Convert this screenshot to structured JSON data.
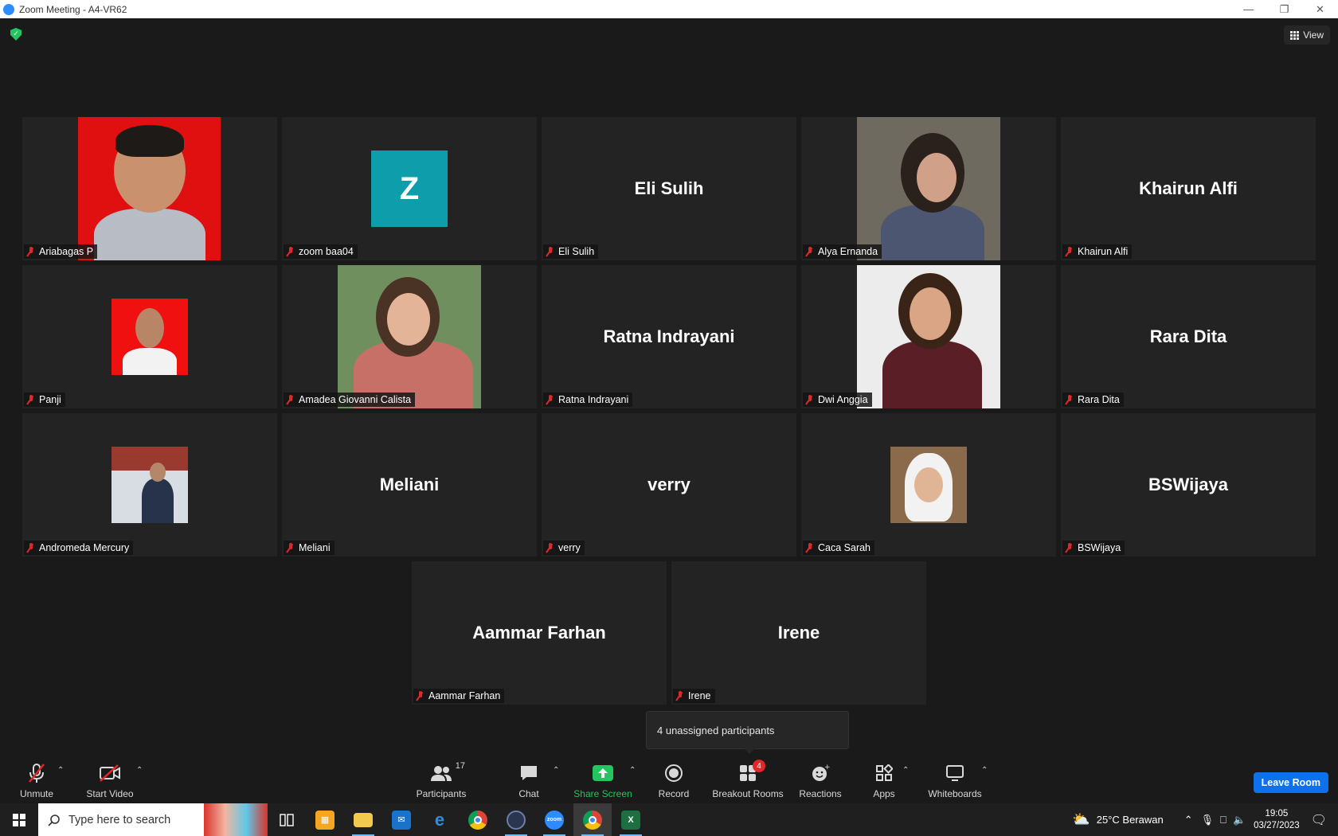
{
  "window": {
    "title": "Zoom Meeting - A4-VR62",
    "minimize_icon": "minimize-icon",
    "restore_icon": "restore-icon",
    "close_icon": "close-icon"
  },
  "header": {
    "view_label": "View"
  },
  "participants": [
    {
      "name": "Ariabagas P",
      "big_name": "",
      "has_photo": true
    },
    {
      "name": "zoom baa04",
      "big_name": "",
      "avatar_letter": "Z"
    },
    {
      "name": "Eli Sulih",
      "big_name": "Eli Sulih"
    },
    {
      "name": "Alya Ernanda",
      "big_name": "",
      "has_photo": true
    },
    {
      "name": "Khairun Alfi",
      "big_name": "Khairun Alfi"
    },
    {
      "name": "Panji",
      "big_name": "",
      "has_photo": true
    },
    {
      "name": "Amadea Giovanni Calista",
      "big_name": "",
      "has_photo": true
    },
    {
      "name": "Ratna Indrayani",
      "big_name": "Ratna Indrayani"
    },
    {
      "name": "Dwi Anggia",
      "big_name": "",
      "has_photo": true
    },
    {
      "name": "Rara Dita",
      "big_name": "Rara Dita"
    },
    {
      "name": "Andromeda Mercury",
      "big_name": "",
      "has_photo": true
    },
    {
      "name": "Meliani",
      "big_name": "Meliani"
    },
    {
      "name": "verry",
      "big_name": "verry"
    },
    {
      "name": "Caca Sarah",
      "big_name": "",
      "has_photo": true
    },
    {
      "name": "BSWijaya",
      "big_name": "BSWijaya"
    },
    {
      "name": "Aammar Farhan",
      "big_name": "Aammar Farhan"
    },
    {
      "name": "Irene",
      "big_name": "Irene"
    }
  ],
  "popup": {
    "text": "4 unassigned participants"
  },
  "toolbar": {
    "unmute": "Unmute",
    "start_video": "Start Video",
    "participants": "Participants",
    "participants_count": "17",
    "chat": "Chat",
    "share_screen": "Share Screen",
    "record": "Record",
    "breakout_rooms": "Breakout Rooms",
    "breakout_badge": "4",
    "reactions": "Reactions",
    "apps": "Apps",
    "whiteboards": "Whiteboards",
    "leave_room": "Leave Room"
  },
  "taskbar": {
    "search_placeholder": "Type here to search",
    "weather": "25°C  Berawan",
    "time": "19:05",
    "date": "03/27/2023"
  },
  "colors": {
    "accent": "#0e71eb",
    "share_green": "#23c55e",
    "mute_red": "#e02828",
    "avatar_teal": "#0e9dab"
  }
}
